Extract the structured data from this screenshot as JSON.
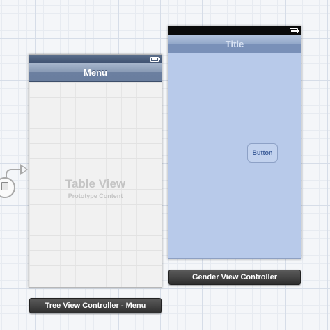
{
  "scenes": {
    "tree": {
      "nav_title": "Menu",
      "table_title": "Table View",
      "table_subtitle": "Prototype Content",
      "dock_label": "Tree View Controller - Menu"
    },
    "gender": {
      "nav_title": "Title",
      "button_label": "Button",
      "dock_label": "Gender View Controller"
    }
  },
  "icons": {
    "battery": "battery-icon",
    "segue": "segue-icon"
  },
  "colors": {
    "canvas": "#f4f6f9",
    "gender_view_bg": "#b8caea",
    "tree_view_bg": "#efefef",
    "dock_bg": "#3a3a3a"
  }
}
